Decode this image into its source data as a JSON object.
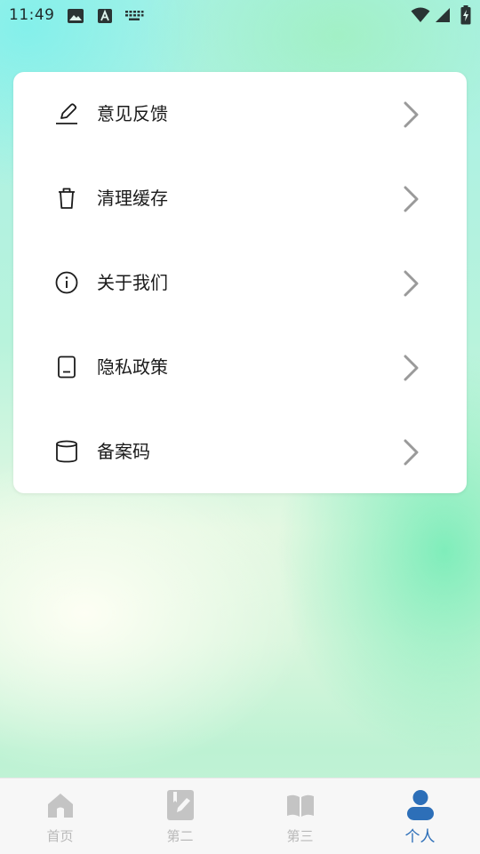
{
  "status_bar": {
    "time": "11:49",
    "icons": [
      "image-icon",
      "a-letter-icon",
      "keyboard-icon",
      "wifi-icon",
      "signal-icon",
      "battery-charging-icon"
    ]
  },
  "menu": {
    "items": [
      {
        "label": "意见反馈",
        "icon": "edit-pen-icon"
      },
      {
        "label": "清理缓存",
        "icon": "trash-icon"
      },
      {
        "label": "关于我们",
        "icon": "info-icon"
      },
      {
        "label": "隐私政策",
        "icon": "document-icon"
      },
      {
        "label": "备案码",
        "icon": "cylinder-icon"
      }
    ]
  },
  "bottom_nav": {
    "tabs": [
      {
        "label": "首页",
        "icon": "home-icon",
        "active": false
      },
      {
        "label": "第二",
        "icon": "pencil-note-icon",
        "active": false
      },
      {
        "label": "第三",
        "icon": "book-icon",
        "active": false
      },
      {
        "label": "个人",
        "icon": "person-icon",
        "active": true
      }
    ]
  },
  "colors": {
    "active_tab": "#2d6fb8",
    "inactive_tab": "#b9b9b9",
    "card_background": "#ffffff",
    "chevron": "#9a9a9a"
  }
}
